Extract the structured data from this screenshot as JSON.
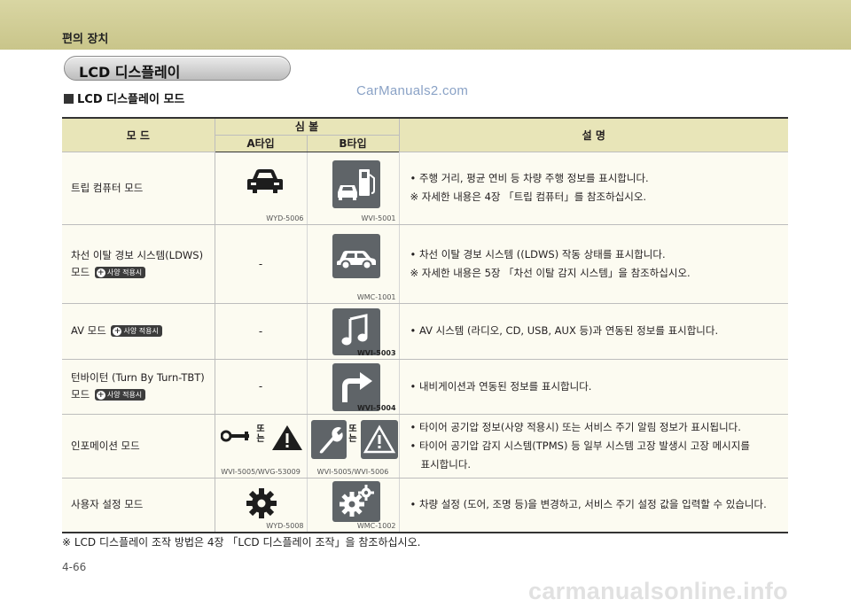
{
  "page": {
    "section_header": "편의 장치",
    "title_pill": "LCD 디스플레이",
    "subheading": "LCD 디스플레이 모드",
    "watermark": "CarManuals2.com",
    "footnote": "※ LCD 디스플레이 조작 방법은 4장 「LCD 디스플레이 조작」을 참조하십시오.",
    "page_number": "4-66",
    "site_watermark": "carmanualsonline.info"
  },
  "table": {
    "header": {
      "mode": "모  드",
      "symbol": "심  볼",
      "type_a": "A타입",
      "type_b": "B타입",
      "description": "설        명"
    },
    "badge_text": "사양 적용시",
    "ddo": [
      "또",
      "는"
    ],
    "rows": [
      {
        "mode": "트립 컴퓨터 모드",
        "icon_a": "car-front-icon",
        "icon_b": "car-fuel-pump-icon",
        "code_a": "WYD-5006",
        "code_b": "WVI-5001",
        "desc1": "• 주행 거리, 평균 연비 등 차량 주행 정보를 표시합니다.",
        "desc2": "※ 자세한 내용은 4장 「트립 컴퓨터」를 참조하십시오."
      },
      {
        "mode_line1": "차선 이탈 경보 시스템(LDWS)",
        "mode_line2": "모드",
        "dash": "-",
        "icon_b": "car-side-icon",
        "code_b": "WMC-1001",
        "desc1": "• 차선 이탈 경보 시스템 ((LDWS) 작동 상태를 표시합니다.",
        "desc2": "※ 자세한 내용은 5장 「차선 이탈 감지 시스템」을  참조하십시오."
      },
      {
        "mode": "AV 모드",
        "dash": "-",
        "icon_b": "music-note-icon",
        "code_b": "WVI-5003",
        "desc1": "• AV 시스템 (라디오, CD, USB, AUX 등)과 연동된 정보를 표시합니다."
      },
      {
        "mode_line1": "턴바이턴 (Turn By Turn-TBT)",
        "mode_line2": "모드",
        "dash": "-",
        "icon_b": "turn-arrow-icon",
        "code_b": "WVI-5004",
        "desc1": "• 내비게이션과 연동된 정보를 표시합니다."
      },
      {
        "mode": "인포메이션 모드",
        "icon_a1": "wrench-icon",
        "icon_a2": "warning-triangle-icon",
        "icon_b1": "wrench-icon",
        "icon_b2": "warning-triangle-icon",
        "code_a": "WVI-5005/WVG-53009",
        "code_b": "WVI-5005/WVI-5006",
        "desc1": "• 타이어 공기압 정보(사양 적용시) 또는 서비스 주기 알림 정보가 표시됩니다.",
        "desc2": "• 타이어 공기압 감지 시스템(TPMS) 등 일부 시스템 고장 발생시 고장 메시지를",
        "desc3": "표시합니다."
      },
      {
        "mode": "사용자 설정 모드",
        "icon_a": "gear-icon",
        "icon_b": "gears-icon",
        "code_a": "WYD-5008",
        "code_b": "WMC-1002",
        "desc1": "• 차량 설정 (도어, 조명 등)을 변경하고, 서비스 주기 설정 값을 입력할 수 있습니다."
      }
    ]
  }
}
